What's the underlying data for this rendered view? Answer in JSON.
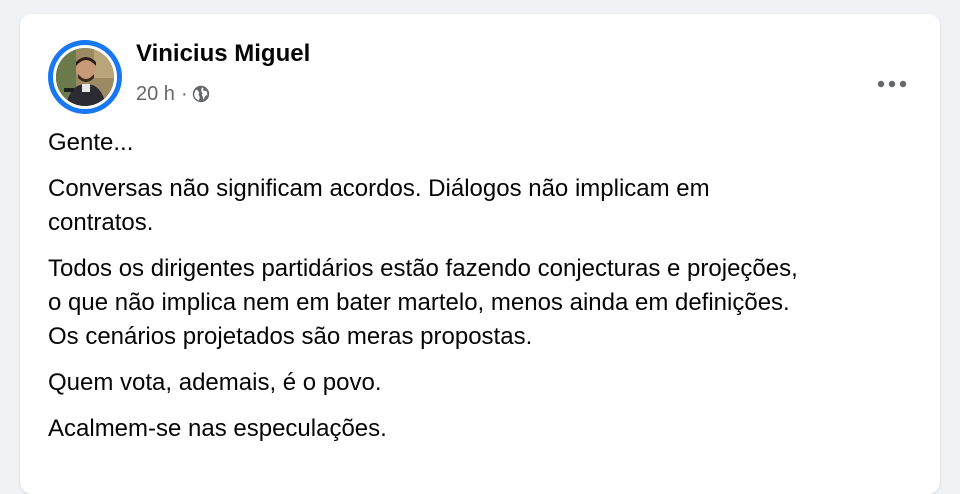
{
  "post": {
    "author": "Vinicius Miguel",
    "time": "20 h",
    "separator": "·",
    "privacy_icon": "globe-icon",
    "more_icon": "more-options-icon",
    "paragraphs": [
      "Gente...",
      "Conversas não significam acordos. Diálogos não implicam em\ncontratos.",
      "Todos os dirigentes partidários estão fazendo conjecturas e projeções,\no que não implica nem em bater martelo, menos ainda em definições.\nOs cenários projetados são meras propostas.",
      "Quem vota, ademais, é o povo.",
      "Acalmem-se nas especulações."
    ]
  },
  "colors": {
    "page_background": "#f0f2f5",
    "card_background": "#ffffff",
    "avatar_ring": "#1877f2",
    "secondary_text": "#65676b",
    "primary_text": "#050505"
  }
}
